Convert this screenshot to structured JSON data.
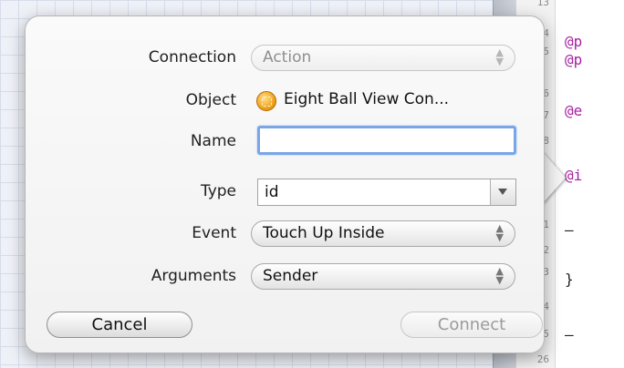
{
  "gutter": {
    "line_numbers": [
      "13",
      "4",
      "5",
      "6",
      "7",
      "8",
      "1",
      "2",
      "3",
      "4",
      "5",
      "26"
    ]
  },
  "editor": {
    "lines": [
      "@p",
      "@p",
      "@e",
      "@i",
      "–",
      "}",
      "–"
    ]
  },
  "popover": {
    "labels": {
      "connection": "Connection",
      "object": "Object",
      "name": "Name",
      "type": "Type",
      "event": "Event",
      "arguments": "Arguments"
    },
    "connection": {
      "value": "Action",
      "enabled": false
    },
    "object": {
      "value": "Eight Ball View Con...",
      "icon": "view-controller-icon"
    },
    "name": {
      "value": "",
      "placeholder": ""
    },
    "type": {
      "value": "id"
    },
    "event": {
      "value": "Touch Up Inside"
    },
    "arguments": {
      "value": "Sender"
    },
    "buttons": {
      "cancel": "Cancel",
      "connect": "Connect"
    }
  },
  "colors": {
    "focus_ring": "#7aa6e6",
    "keyword": "#a6209f",
    "disabled_text": "#9b9b9b"
  }
}
